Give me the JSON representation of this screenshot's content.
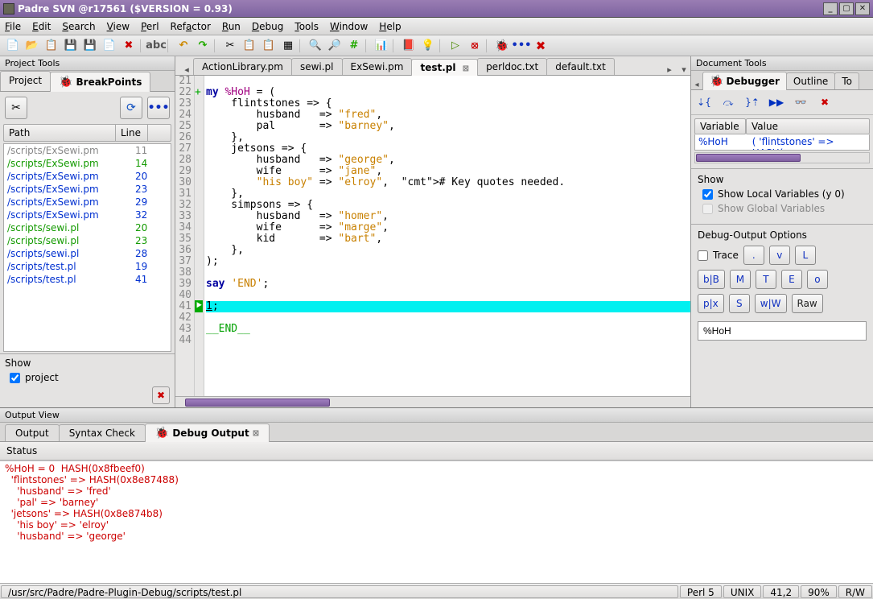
{
  "title": "Padre SVN @r17561 ($VERSION = 0.93)",
  "menu": [
    "File",
    "Edit",
    "Search",
    "View",
    "Perl",
    "Refactor",
    "Run",
    "Debug",
    "Tools",
    "Window",
    "Help"
  ],
  "left_panel": {
    "title": "Project Tools",
    "tabs": {
      "project": "Project",
      "breakpoints": "BreakPoints"
    },
    "columns": {
      "path": "Path",
      "line": "Line"
    },
    "rows": [
      {
        "path": "/scripts/ExSewi.pm",
        "line": "11",
        "cls": "gray"
      },
      {
        "path": "/scripts/ExSewi.pm",
        "line": "14",
        "cls": "green"
      },
      {
        "path": "/scripts/ExSewi.pm",
        "line": "20",
        "cls": "blue"
      },
      {
        "path": "/scripts/ExSewi.pm",
        "line": "23",
        "cls": "blue"
      },
      {
        "path": "/scripts/ExSewi.pm",
        "line": "29",
        "cls": "blue"
      },
      {
        "path": "/scripts/ExSewi.pm",
        "line": "32",
        "cls": "blue"
      },
      {
        "path": "/scripts/sewi.pl",
        "line": "20",
        "cls": "green"
      },
      {
        "path": "/scripts/sewi.pl",
        "line": "23",
        "cls": "green"
      },
      {
        "path": "/scripts/sewi.pl",
        "line": "28",
        "cls": "blue"
      },
      {
        "path": "/scripts/test.pl",
        "line": "19",
        "cls": "blue"
      },
      {
        "path": "/scripts/test.pl",
        "line": "41",
        "cls": "blue"
      }
    ],
    "show_label": "Show",
    "show_project": "project"
  },
  "center": {
    "file_tabs": [
      "ActionLibrary.pm",
      "sewi.pl",
      "ExSewi.pm",
      "test.pl",
      "perldoc.txt",
      "default.txt"
    ],
    "active_tab": "test.pl",
    "first_line": 21,
    "lines": [
      "",
      "my %HoH = (",
      "    flintstones => {",
      "        husband   => \"fred\",",
      "        pal       => \"barney\",",
      "    },",
      "    jetsons => {",
      "        husband   => \"george\",",
      "        wife      => \"jane\",",
      "        \"his boy\" => \"elroy\",  # Key quotes needed.",
      "    },",
      "    simpsons => {",
      "        husband   => \"homer\",",
      "        wife      => \"marge\",",
      "        kid       => \"bart\",",
      "    },",
      ");",
      "",
      "say 'END';",
      "",
      "1;",
      "",
      "__END__",
      ""
    ]
  },
  "right_panel": {
    "title": "Document Tools",
    "tabs": [
      "Debugger",
      "Outline",
      "To"
    ],
    "var_header": {
      "name": "Variable",
      "value": "Value"
    },
    "var_row": {
      "name": "%HoH",
      "value": "(   'flintstones' => HASH("
    },
    "show_label": "Show",
    "show_local": "Show Local Variables (y 0)",
    "show_global": "Show Global Variables",
    "dbg_opts": "Debug-Output Options",
    "trace": "Trace",
    "btns1": [
      ".",
      "v",
      "L"
    ],
    "btns2": [
      "b|B",
      "M",
      "T",
      "E",
      "o"
    ],
    "btns3": [
      "p|x",
      "S",
      "w|W",
      "Raw"
    ],
    "expr": "%HoH"
  },
  "bottom": {
    "title": "Output View",
    "tabs": [
      "Output",
      "Syntax Check",
      "Debug Output"
    ],
    "status_label": "Status",
    "lines": [
      "%HoH = 0  HASH(0x8fbeef0)",
      "  'flintstones' => HASH(0x8e87488)",
      "    'husband' => 'fred'",
      "    'pal' => 'barney'",
      "  'jetsons' => HASH(0x8e874b8)",
      "    'his boy' => 'elroy'",
      "    'husband' => 'george'"
    ]
  },
  "statusbar": {
    "path": "/usr/src/Padre/Padre-Plugin-Debug/scripts/test.pl",
    "lang": "Perl 5",
    "os": "UNIX",
    "pos": "41,2",
    "zoom": "90%",
    "mode": "R/W"
  }
}
